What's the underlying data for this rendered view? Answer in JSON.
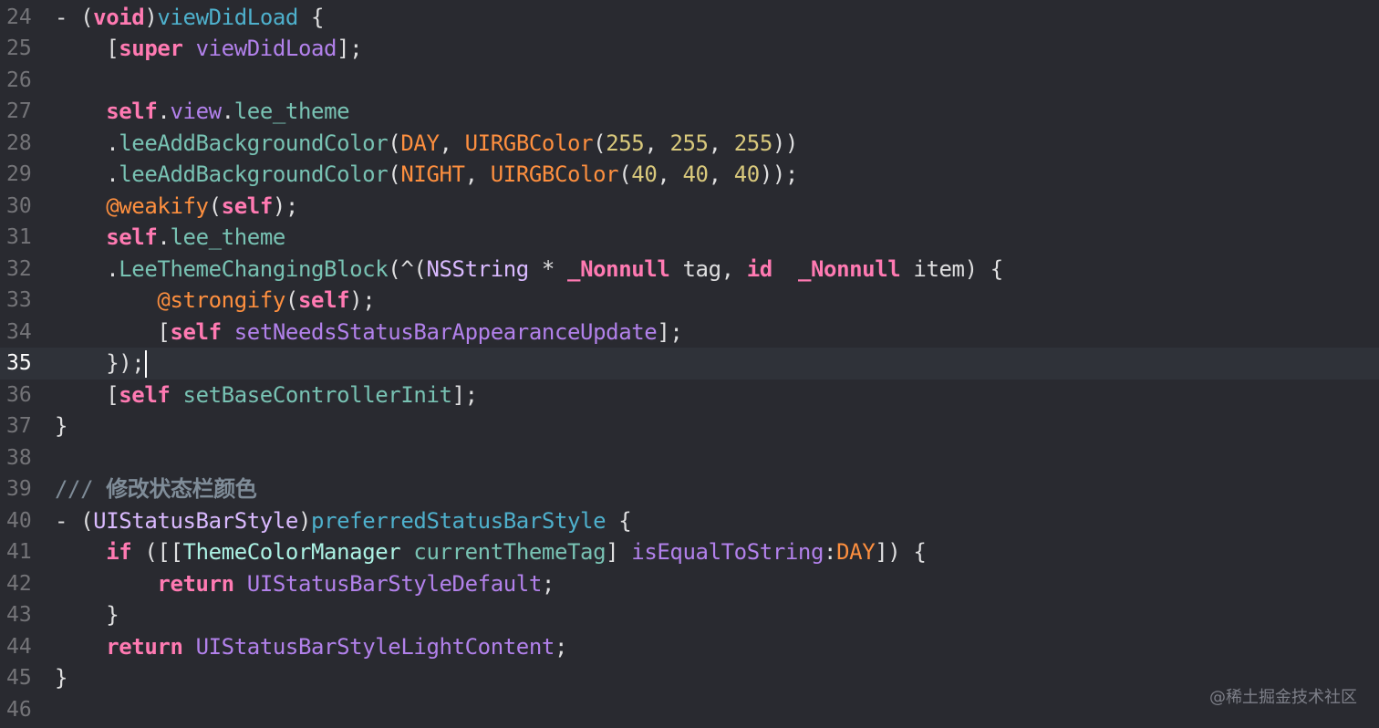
{
  "editor": {
    "current_line": "35",
    "lines": [
      {
        "number": "24",
        "tokens": [
          {
            "t": "- (",
            "c": "plain"
          },
          {
            "t": "void",
            "c": "keyword"
          },
          {
            "t": ")",
            "c": "plain"
          },
          {
            "t": "viewDidLoad",
            "c": "decl"
          },
          {
            "t": " {",
            "c": "plain"
          }
        ]
      },
      {
        "number": "25",
        "tokens": [
          {
            "t": "    [",
            "c": "plain"
          },
          {
            "t": "super",
            "c": "keyword"
          },
          {
            "t": " ",
            "c": "plain"
          },
          {
            "t": "viewDidLoad",
            "c": "method"
          },
          {
            "t": "];",
            "c": "plain"
          }
        ]
      },
      {
        "number": "26",
        "tokens": []
      },
      {
        "number": "27",
        "tokens": [
          {
            "t": "    ",
            "c": "plain"
          },
          {
            "t": "self",
            "c": "keyword"
          },
          {
            "t": ".",
            "c": "plain"
          },
          {
            "t": "view",
            "c": "method"
          },
          {
            "t": ".",
            "c": "plain"
          },
          {
            "t": "lee_theme",
            "c": "project"
          }
        ]
      },
      {
        "number": "28",
        "tokens": [
          {
            "t": "    .",
            "c": "plain"
          },
          {
            "t": "leeAddBackgroundColor",
            "c": "project"
          },
          {
            "t": "(",
            "c": "plain"
          },
          {
            "t": "DAY",
            "c": "macro"
          },
          {
            "t": ", ",
            "c": "plain"
          },
          {
            "t": "UIRGBColor",
            "c": "macro"
          },
          {
            "t": "(",
            "c": "plain"
          },
          {
            "t": "255",
            "c": "number"
          },
          {
            "t": ", ",
            "c": "plain"
          },
          {
            "t": "255",
            "c": "number"
          },
          {
            "t": ", ",
            "c": "plain"
          },
          {
            "t": "255",
            "c": "number"
          },
          {
            "t": "))",
            "c": "plain"
          }
        ]
      },
      {
        "number": "29",
        "tokens": [
          {
            "t": "    .",
            "c": "plain"
          },
          {
            "t": "leeAddBackgroundColor",
            "c": "project"
          },
          {
            "t": "(",
            "c": "plain"
          },
          {
            "t": "NIGHT",
            "c": "macro"
          },
          {
            "t": ", ",
            "c": "plain"
          },
          {
            "t": "UIRGBColor",
            "c": "macro"
          },
          {
            "t": "(",
            "c": "plain"
          },
          {
            "t": "40",
            "c": "number"
          },
          {
            "t": ", ",
            "c": "plain"
          },
          {
            "t": "40",
            "c": "number"
          },
          {
            "t": ", ",
            "c": "plain"
          },
          {
            "t": "40",
            "c": "number"
          },
          {
            "t": "));",
            "c": "plain"
          }
        ]
      },
      {
        "number": "30",
        "tokens": [
          {
            "t": "    ",
            "c": "plain"
          },
          {
            "t": "@weakify",
            "c": "macro"
          },
          {
            "t": "(",
            "c": "plain"
          },
          {
            "t": "self",
            "c": "keyword"
          },
          {
            "t": ");",
            "c": "plain"
          }
        ]
      },
      {
        "number": "31",
        "tokens": [
          {
            "t": "    ",
            "c": "plain"
          },
          {
            "t": "self",
            "c": "keyword"
          },
          {
            "t": ".",
            "c": "plain"
          },
          {
            "t": "lee_theme",
            "c": "project"
          }
        ]
      },
      {
        "number": "32",
        "tokens": [
          {
            "t": "    .",
            "c": "plain"
          },
          {
            "t": "LeeThemeChangingBlock",
            "c": "project"
          },
          {
            "t": "(^(",
            "c": "plain"
          },
          {
            "t": "NSString",
            "c": "type"
          },
          {
            "t": " * ",
            "c": "plain"
          },
          {
            "t": "_Nonnull",
            "c": "keyword"
          },
          {
            "t": " tag, ",
            "c": "plain"
          },
          {
            "t": "id",
            "c": "keyword"
          },
          {
            "t": "  ",
            "c": "plain"
          },
          {
            "t": "_Nonnull",
            "c": "keyword"
          },
          {
            "t": " item) {",
            "c": "plain"
          }
        ]
      },
      {
        "number": "33",
        "tokens": [
          {
            "t": "        ",
            "c": "plain"
          },
          {
            "t": "@strongify",
            "c": "macro"
          },
          {
            "t": "(",
            "c": "plain"
          },
          {
            "t": "self",
            "c": "keyword"
          },
          {
            "t": ");",
            "c": "plain"
          }
        ]
      },
      {
        "number": "34",
        "tokens": [
          {
            "t": "        [",
            "c": "plain"
          },
          {
            "t": "self",
            "c": "keyword"
          },
          {
            "t": " ",
            "c": "plain"
          },
          {
            "t": "setNeedsStatusBarAppearanceUpdate",
            "c": "method"
          },
          {
            "t": "];",
            "c": "plain"
          }
        ]
      },
      {
        "number": "35",
        "tokens": [
          {
            "t": "    });",
            "c": "plain"
          }
        ],
        "caret": true
      },
      {
        "number": "36",
        "tokens": [
          {
            "t": "    [",
            "c": "plain"
          },
          {
            "t": "self",
            "c": "keyword"
          },
          {
            "t": " ",
            "c": "plain"
          },
          {
            "t": "setBaseControllerInit",
            "c": "project"
          },
          {
            "t": "];",
            "c": "plain"
          }
        ]
      },
      {
        "number": "37",
        "tokens": [
          {
            "t": "}",
            "c": "plain"
          }
        ]
      },
      {
        "number": "38",
        "tokens": []
      },
      {
        "number": "39",
        "tokens": [
          {
            "t": "/// ",
            "c": "comment"
          },
          {
            "t": "修改状态栏颜色",
            "c": "cjk"
          }
        ]
      },
      {
        "number": "40",
        "tokens": [
          {
            "t": "- (",
            "c": "plain"
          },
          {
            "t": "UIStatusBarStyle",
            "c": "type"
          },
          {
            "t": ")",
            "c": "plain"
          },
          {
            "t": "preferredStatusBarStyle",
            "c": "decl"
          },
          {
            "t": " {",
            "c": "plain"
          }
        ]
      },
      {
        "number": "41",
        "tokens": [
          {
            "t": "    ",
            "c": "plain"
          },
          {
            "t": "if",
            "c": "keyword"
          },
          {
            "t": " ([[",
            "c": "plain"
          },
          {
            "t": "ThemeColorManager",
            "c": "class"
          },
          {
            "t": " ",
            "c": "plain"
          },
          {
            "t": "currentThemeTag",
            "c": "project"
          },
          {
            "t": "] ",
            "c": "plain"
          },
          {
            "t": "isEqualToString",
            "c": "method"
          },
          {
            "t": ":",
            "c": "plain"
          },
          {
            "t": "DAY",
            "c": "macro"
          },
          {
            "t": "]) {",
            "c": "plain"
          }
        ]
      },
      {
        "number": "42",
        "tokens": [
          {
            "t": "        ",
            "c": "plain"
          },
          {
            "t": "return",
            "c": "keyword"
          },
          {
            "t": " ",
            "c": "plain"
          },
          {
            "t": "UIStatusBarStyleDefault",
            "c": "method"
          },
          {
            "t": ";",
            "c": "plain"
          }
        ]
      },
      {
        "number": "43",
        "tokens": [
          {
            "t": "    }",
            "c": "plain"
          }
        ]
      },
      {
        "number": "44",
        "tokens": [
          {
            "t": "    ",
            "c": "plain"
          },
          {
            "t": "return",
            "c": "keyword"
          },
          {
            "t": " ",
            "c": "plain"
          },
          {
            "t": "UIStatusBarStyleLightContent",
            "c": "method"
          },
          {
            "t": ";",
            "c": "plain"
          }
        ]
      },
      {
        "number": "45",
        "tokens": [
          {
            "t": "}",
            "c": "plain"
          }
        ]
      },
      {
        "number": "46",
        "tokens": []
      }
    ]
  },
  "watermark": "@稀土掘金技术社区",
  "colors": {
    "background": "#292a30",
    "current_line": "#2f3239",
    "plain": "#dfdfe0",
    "keyword": "#ff7ab2",
    "decl": "#4eb0cc",
    "method": "#b281eb",
    "project": "#78c2b3",
    "macro": "#fd8f3f",
    "number": "#d9c97c",
    "type": "#dabaff",
    "class": "#acf2e4",
    "comment": "#7f8c98"
  }
}
